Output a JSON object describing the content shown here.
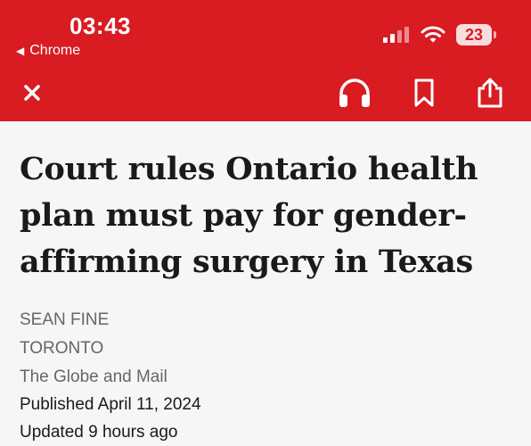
{
  "status_bar": {
    "time": "03:43",
    "back_app": "Chrome",
    "battery": "23"
  },
  "toolbar": {
    "close_icon": "close-icon",
    "listen_icon": "headphones-icon",
    "bookmark_icon": "bookmark-icon",
    "share_icon": "share-icon"
  },
  "colors": {
    "brand_red": "#d81c22",
    "background": "#f6f6f6",
    "headline_text": "#1a1a1a",
    "meta_text": "#666666"
  },
  "article": {
    "headline_lines": [
      "Court rules Ontario health",
      "plan must pay for gender-",
      "affirming surgery in Texas"
    ],
    "author": "SEAN FINE",
    "location": "TORONTO",
    "publisher": "The Globe and Mail",
    "published": "Published April 11, 2024",
    "updated": "Updated 9 hours ago"
  }
}
